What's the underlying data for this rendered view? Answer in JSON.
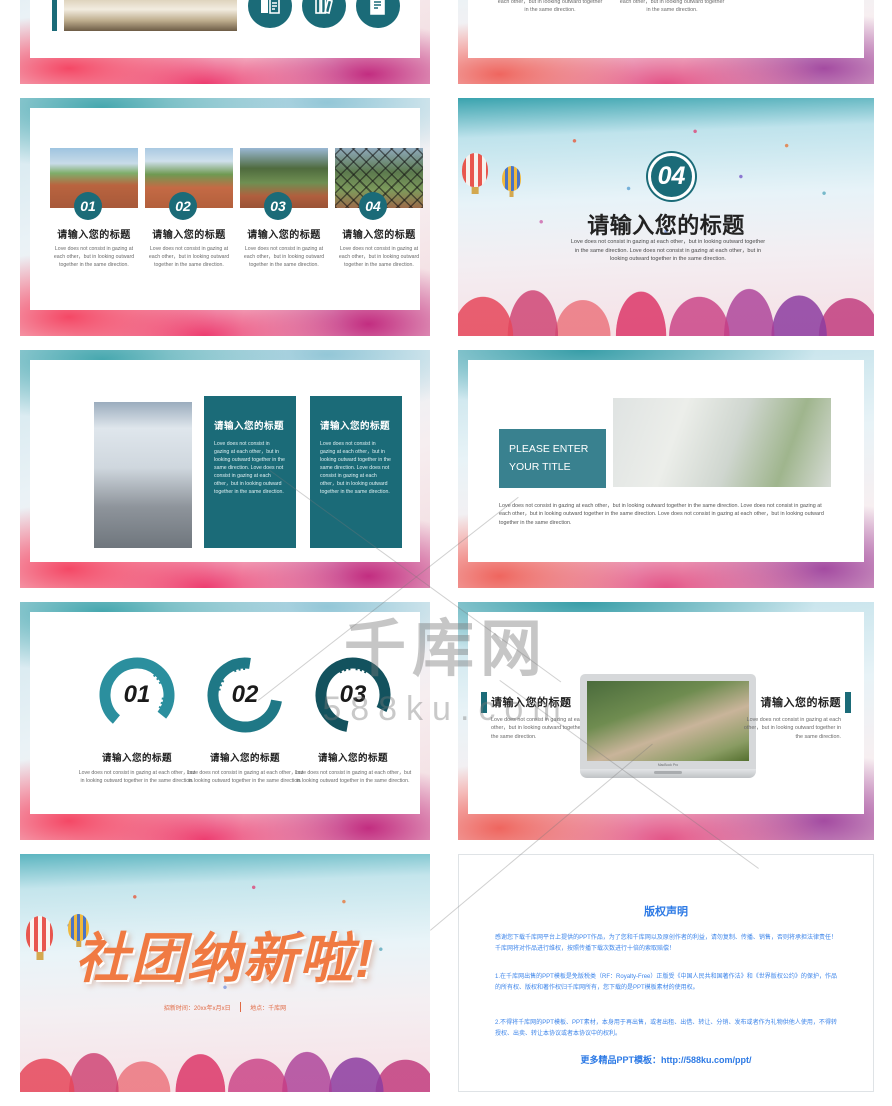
{
  "meta": {
    "watermark_cn": "千库网",
    "watermark_en": "588ku.com"
  },
  "common": {
    "cn_title": "请输入您的标题",
    "en_body": "Love does not consist in gazing at each other，but in looking outward together in the same direction.",
    "en_body_long": "Love does not consist in gazing at each other，but in looking outward together in the same direction. Love does not consist in gazing at each other，but in looking outward together in the same direction.",
    "en_body_xlong": "Love does not consist in gazing at each other，but in looking outward together in the same direction. Love does not consist in gazing at each other，but in looking outward together in the same direction. Love does not consist in gazing at each other，but in looking outward together in the same direction."
  },
  "slides": [
    {
      "id": "slide-books",
      "name": "books-icons-slide",
      "icons": [
        "open-book-icon",
        "bookshelf-icon",
        "notebook-icon"
      ]
    },
    {
      "id": "slide-two-column-text",
      "name": "two-column-text-slide",
      "columns": [
        {
          "body": "each other，but in looking outward together in the same direction."
        },
        {
          "body": "each other，but in looking outward together in the same direction."
        }
      ]
    },
    {
      "id": "slide-four-photo-grid",
      "name": "four-photo-grid-slide",
      "items": [
        {
          "number": "01",
          "title": "请输入您的标题",
          "body": "Love does not consist in gazing at each other，but in looking outward together in the same direction.",
          "photo": "track-field-photo"
        },
        {
          "number": "02",
          "title": "请输入您的标题",
          "body": "Love does not consist in gazing at each other，but in looking outward together in the same direction.",
          "photo": "campus-building-photo"
        },
        {
          "number": "03",
          "title": "请输入您的标题",
          "body": "Love does not consist in gazing at each other，but in looking outward together in the same direction.",
          "photo": "sports-field-photo"
        },
        {
          "number": "04",
          "title": "请输入您的标题",
          "body": "Love does not consist in gazing at each other，but in looking outward together in the same direction.",
          "photo": "fence-photo"
        }
      ]
    },
    {
      "id": "slide-section-04",
      "name": "section-divider-slide",
      "number": "04",
      "title": "请输入您的标题",
      "body": "Love does not consist in gazing at each other，but in looking outward together in the same direction. Love does not consist in gazing at each other，but in looking outward together in the same direction."
    },
    {
      "id": "slide-image-two-panels",
      "name": "image-two-panel-slide",
      "panels": [
        {
          "title": "请输入您的标题",
          "body": "Love does not consist in gazing at each other，but in looking outward together in the same direction. Love does not consist in gazing at each other，but in looking outward together in the same direction."
        },
        {
          "title": "请输入您的标题",
          "body": "Love does not consist in gazing at each other，but in looking outward together in the same direction. Love does not consist in gazing at each other，but in looking outward together in the same direction."
        }
      ]
    },
    {
      "id": "slide-please-enter-title",
      "name": "classroom-photo-slide",
      "title_line1": "PLEASE ENTER",
      "title_line2": "YOUR TITLE",
      "body": "Love does not consist in gazing at each other，but in looking outward together in the same direction. Love does not consist in gazing at each other，but in looking outward together in the same direction. Love does not consist in gazing at each other，but in looking outward together in the same direction."
    },
    {
      "id": "slide-three-donuts",
      "name": "three-donut-slide",
      "items": [
        {
          "number": "01",
          "title": "请输入您的标题",
          "body": "Love does not consist in gazing at each other，but in looking outward together in the same direction.",
          "color": "#2b8f9e"
        },
        {
          "number": "02",
          "title": "请输入您的标题",
          "body": "Love does not consist in gazing at each other，but in looking outward together in the same direction.",
          "color": "#1f7886"
        },
        {
          "number": "03",
          "title": "请输入您的标题",
          "body": "Love does not consist in gazing at each other，but in looking outward together in the same direction.",
          "color": "#13525e"
        }
      ]
    },
    {
      "id": "slide-laptop",
      "name": "laptop-mockup-slide",
      "laptop_label": "MacBook Pro",
      "left": {
        "title": "请输入您的标题",
        "body": "Love does not consist in gazing at each other，but in looking outward together in the same direction."
      },
      "right": {
        "title": "请输入您的标题",
        "body": "Love does not consist in gazing at each other，but in looking outward together in the same direction."
      }
    },
    {
      "id": "slide-closing",
      "name": "closing-title-slide",
      "headline": "社团纳新啦!",
      "meta_time": "招新时间：20xx年x月x日",
      "meta_place": "地点：千库网"
    },
    {
      "id": "slide-copyright",
      "name": "copyright-notice-slide",
      "title": "版权声明",
      "paragraphs": [
        "感谢您下载千库网平台上提供的PPT作品，为了您和千库网以及原创作者的利益，请勿复制、传播、销售，否则将承担法律责任！千库网将对作品进行维权，按照传播下载次数进行十倍的索取赔偿！",
        "1.在千库网出售的PPT模板是免版税类（RF：Royalty-Free）正版受《中国人民共和国著作法》和《世界版权公约》的保护，作品的所有权、版权和著作权归千库网所有，您下载的是PPT模板素材的使用权。",
        "2.不得将千库网的PPT模板、PPT素材，本身用于再出售，或者出租、出借、转让、分销、发布或者作为礼物供他人使用，不得转授权、出卖、转让本协议或者本协议中的权利。"
      ],
      "footer_label": "更多精品PPT模板：",
      "footer_url": "http://588ku.com/ppt/"
    }
  ]
}
